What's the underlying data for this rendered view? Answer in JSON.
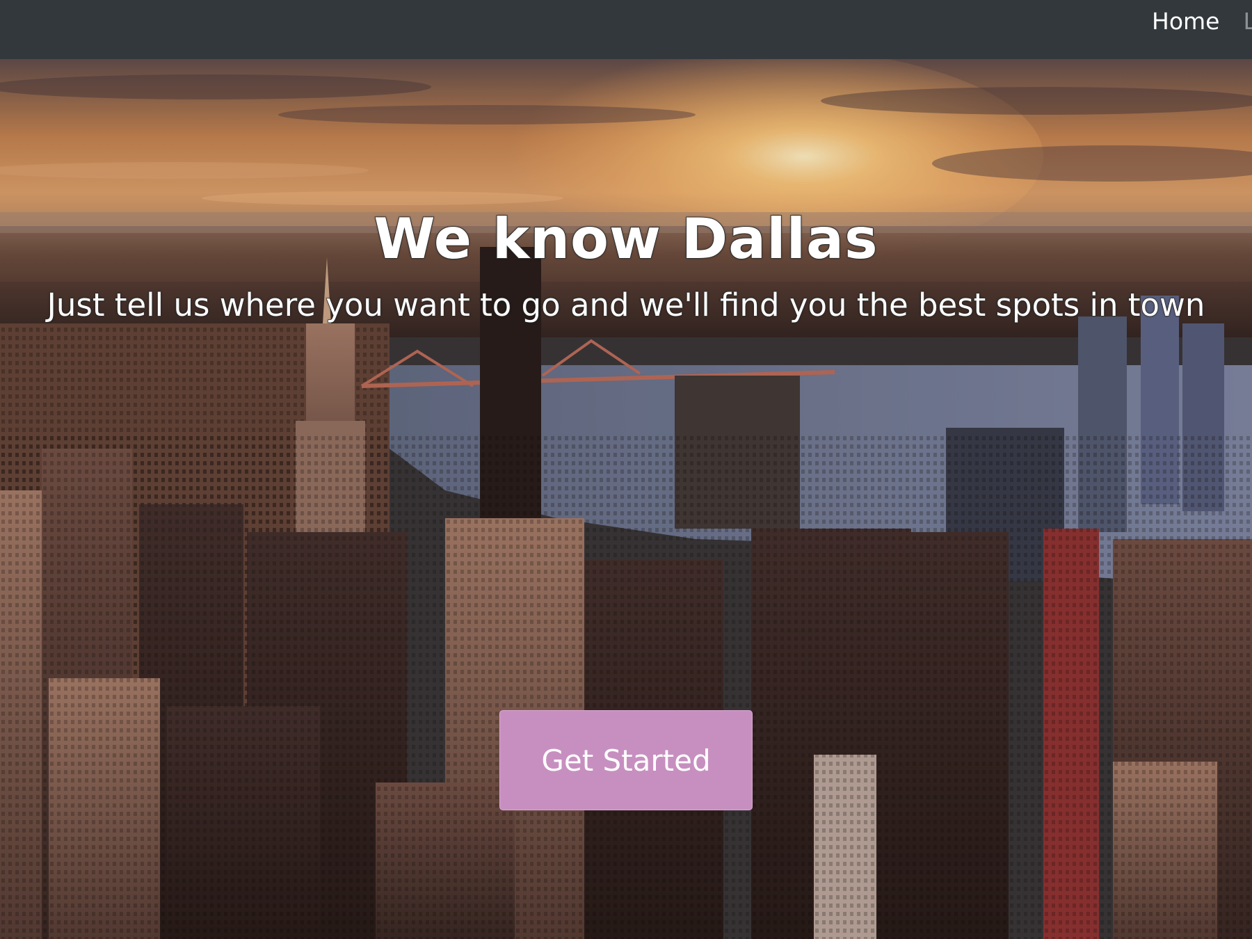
{
  "navbar": {
    "links": [
      {
        "label": "Home"
      },
      {
        "label": "Lo"
      }
    ]
  },
  "hero": {
    "title": "We know Dallas",
    "subtitle": "Just tell us where you want to go and we'll find you the best spots in town",
    "cta_label": "Get Started",
    "background": "city-skyline-sunset-photo"
  },
  "colors": {
    "navbar": "#33383c",
    "cta": "#c78fc0",
    "text": "#ffffff"
  }
}
